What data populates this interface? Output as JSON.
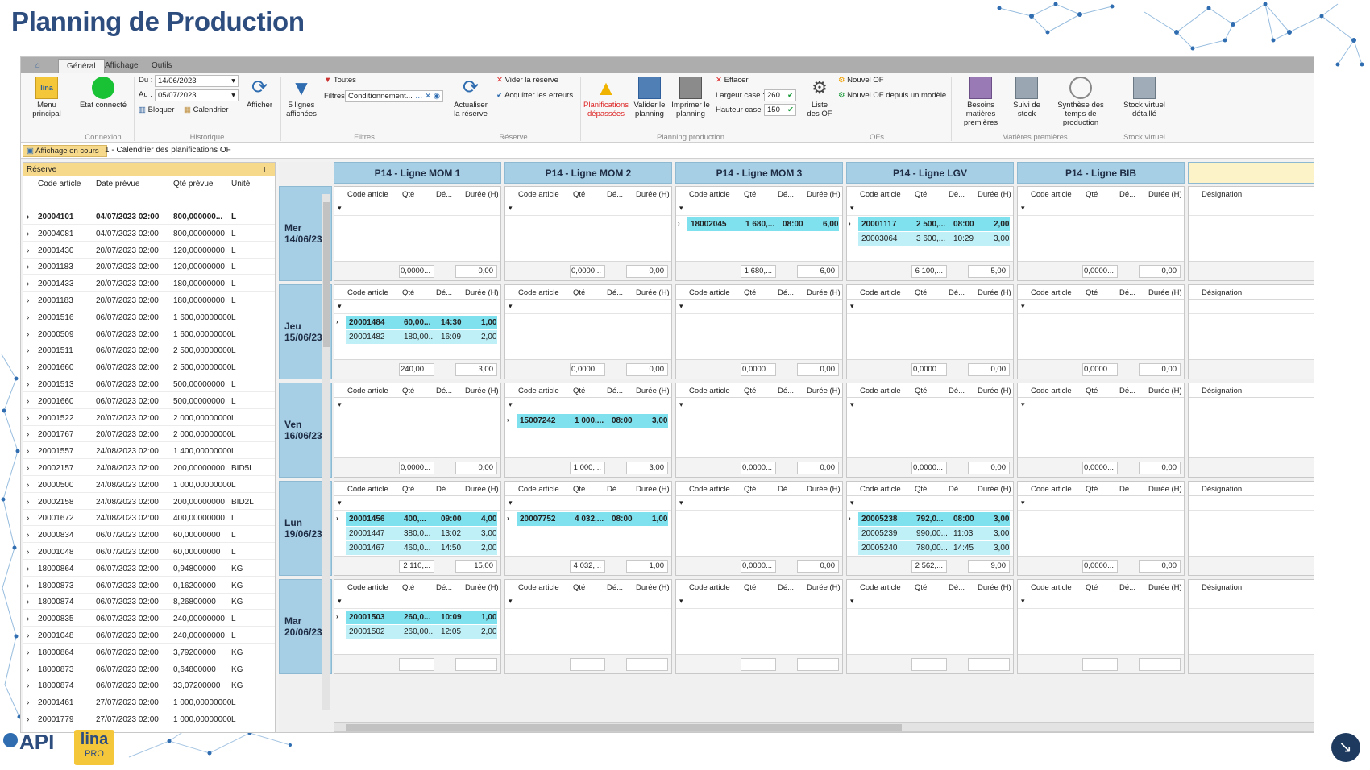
{
  "page_title": "Planning de Production",
  "tabs": [
    "Général",
    "Affichage",
    "Outils"
  ],
  "ribbon": {
    "menu_principal": "Menu principal",
    "etat_connecte": "Etat connecté",
    "du_label": "Du :",
    "du_value": "14/06/2023",
    "au_label": "Au :",
    "au_value": "05/07/2023",
    "bloquer": "Bloquer",
    "calendrier": "Calendrier",
    "afficher": "Afficher",
    "lignes_affichees": "5 lignes affichées",
    "toutes": "Toutes",
    "filtres_label": "Filtres",
    "filtres_value": "Conditionnement...",
    "actualiser": "Actualiser la réserve",
    "vider": "Vider la réserve",
    "acquitter": "Acquitter les erreurs",
    "planif_depassees": "Planifications dépassées",
    "valider": "Valider le planning",
    "imprimer": "Imprimer le planning",
    "effacer": "Effacer",
    "largeur_label": "Largeur case :",
    "largeur_value": "260",
    "hauteur_label": "Hauteur case :",
    "hauteur_value": "150",
    "liste_of": "Liste des OF",
    "nouvel_of": "Nouvel OF",
    "nouvel_of_modele": "Nouvel OF depuis un modèle",
    "besoins": "Besoins matières premières",
    "suivi_stock": "Suivi de stock",
    "synthese": "Synthèse des temps de production",
    "stock_virtuel": "Stock virtuel détaillé",
    "groups": [
      "Connexion",
      "Historique",
      "Filtres",
      "Réserve",
      "Planning production",
      "OFs",
      "Matières premières",
      "Stock virtuel"
    ]
  },
  "current_view": {
    "label": "Affichage en cours :",
    "value": "1 - Calendrier des planifications OF"
  },
  "reserve": {
    "title": "Réserve",
    "columns": [
      "Code article",
      "Date prévue",
      "Qté prévue",
      "Unité"
    ],
    "rows": [
      [
        "20004101",
        "04/07/2023 02:00",
        "800,000000...",
        "L"
      ],
      [
        "20004081",
        "04/07/2023 02:00",
        "800,00000000",
        "L"
      ],
      [
        "20001430",
        "20/07/2023 02:00",
        "120,00000000",
        "L"
      ],
      [
        "20001183",
        "20/07/2023 02:00",
        "120,00000000",
        "L"
      ],
      [
        "20001433",
        "20/07/2023 02:00",
        "180,00000000",
        "L"
      ],
      [
        "20001183",
        "20/07/2023 02:00",
        "180,00000000",
        "L"
      ],
      [
        "20001516",
        "06/07/2023 02:00",
        "1 600,00000000",
        "L"
      ],
      [
        "20000509",
        "06/07/2023 02:00",
        "1 600,00000000",
        "L"
      ],
      [
        "20001511",
        "06/07/2023 02:00",
        "2 500,00000000",
        "L"
      ],
      [
        "20001660",
        "06/07/2023 02:00",
        "2 500,00000000",
        "L"
      ],
      [
        "20001513",
        "06/07/2023 02:00",
        "500,00000000",
        "L"
      ],
      [
        "20001660",
        "06/07/2023 02:00",
        "500,00000000",
        "L"
      ],
      [
        "20001522",
        "20/07/2023 02:00",
        "2 000,00000000",
        "L"
      ],
      [
        "20001767",
        "20/07/2023 02:00",
        "2 000,00000000",
        "L"
      ],
      [
        "20001557",
        "24/08/2023 02:00",
        "1 400,00000000",
        "L"
      ],
      [
        "20002157",
        "24/08/2023 02:00",
        "200,00000000",
        "BID5L"
      ],
      [
        "20000500",
        "24/08/2023 02:00",
        "1 000,00000000",
        "L"
      ],
      [
        "20002158",
        "24/08/2023 02:00",
        "200,00000000",
        "BID2L"
      ],
      [
        "20001672",
        "24/08/2023 02:00",
        "400,00000000",
        "L"
      ],
      [
        "20000834",
        "06/07/2023 02:00",
        "60,00000000",
        "L"
      ],
      [
        "20001048",
        "06/07/2023 02:00",
        "60,00000000",
        "L"
      ],
      [
        "18000864",
        "06/07/2023 02:00",
        "0,94800000",
        "KG"
      ],
      [
        "18000873",
        "06/07/2023 02:00",
        "0,16200000",
        "KG"
      ],
      [
        "18000874",
        "06/07/2023 02:00",
        "8,26800000",
        "KG"
      ],
      [
        "20000835",
        "06/07/2023 02:00",
        "240,00000000",
        "L"
      ],
      [
        "20001048",
        "06/07/2023 02:00",
        "240,00000000",
        "L"
      ],
      [
        "18000864",
        "06/07/2023 02:00",
        "3,79200000",
        "KG"
      ],
      [
        "18000873",
        "06/07/2023 02:00",
        "0,64800000",
        "KG"
      ],
      [
        "18000874",
        "06/07/2023 02:00",
        "33,07200000",
        "KG"
      ],
      [
        "20001461",
        "27/07/2023 02:00",
        "1 000,00000000",
        "L"
      ],
      [
        "20001779",
        "27/07/2023 02:00",
        "1 000,00000000",
        "L"
      ]
    ]
  },
  "planning": {
    "lines": [
      "P14 - Ligne MOM 1",
      "P14 - Ligne MOM 2",
      "P14 - Ligne MOM 3",
      "P14 - Ligne LGV",
      "P14 - Ligne BIB"
    ],
    "cell_columns": [
      "Code article",
      "Qté",
      "Dé...",
      "Durée (H)"
    ],
    "extra_column": "Désignation",
    "days": [
      {
        "name": "Mer",
        "date": "14/06/23",
        "cells": [
          {
            "rows": [],
            "total_qty": "0,0000...",
            "total_dur": "0,00"
          },
          {
            "rows": [],
            "total_qty": "0,0000...",
            "total_dur": "0,00"
          },
          {
            "rows": [
              [
                "18002045",
                "1 680,...",
                "08:00",
                "6,00"
              ]
            ],
            "total_qty": "1 680,...",
            "total_dur": "6,00"
          },
          {
            "rows": [
              [
                "20001117",
                "2 500,...",
                "08:00",
                "2,00"
              ],
              [
                "20003064",
                "3 600,...",
                "10:29",
                "3,00"
              ]
            ],
            "total_qty": "6 100,...",
            "total_dur": "5,00"
          },
          {
            "rows": [],
            "total_qty": "0,0000...",
            "total_dur": "0,00"
          }
        ]
      },
      {
        "name": "Jeu",
        "date": "15/06/23",
        "cells": [
          {
            "rows": [
              [
                "20001484",
                "60,00...",
                "14:30",
                "1,00"
              ],
              [
                "20001482",
                "180,00...",
                "16:09",
                "2,00"
              ]
            ],
            "total_qty": "240,00...",
            "total_dur": "3,00"
          },
          {
            "rows": [],
            "total_qty": "0,0000...",
            "total_dur": "0,00"
          },
          {
            "rows": [],
            "total_qty": "0,0000...",
            "total_dur": "0,00"
          },
          {
            "rows": [],
            "total_qty": "0,0000...",
            "total_dur": "0,00"
          },
          {
            "rows": [],
            "total_qty": "0,0000...",
            "total_dur": "0,00"
          }
        ]
      },
      {
        "name": "Ven",
        "date": "16/06/23",
        "cells": [
          {
            "rows": [],
            "total_qty": "0,0000...",
            "total_dur": "0,00"
          },
          {
            "rows": [
              [
                "15007242",
                "1 000,...",
                "08:00",
                "3,00"
              ]
            ],
            "total_qty": "1 000,...",
            "total_dur": "3,00"
          },
          {
            "rows": [],
            "total_qty": "0,0000...",
            "total_dur": "0,00"
          },
          {
            "rows": [],
            "total_qty": "0,0000...",
            "total_dur": "0,00"
          },
          {
            "rows": [],
            "total_qty": "0,0000...",
            "total_dur": "0,00"
          }
        ]
      },
      {
        "name": "Lun",
        "date": "19/06/23",
        "cells": [
          {
            "rows": [
              [
                "20001456",
                "400,...",
                "09:00",
                "4,00"
              ],
              [
                "20001447",
                "380,0...",
                "13:02",
                "3,00"
              ],
              [
                "20001467",
                "460,0...",
                "14:50",
                "2,00"
              ]
            ],
            "total_qty": "2 110,...",
            "total_dur": "15,00"
          },
          {
            "rows": [
              [
                "20007752",
                "4 032,...",
                "08:00",
                "1,00"
              ]
            ],
            "total_qty": "4 032,...",
            "total_dur": "1,00"
          },
          {
            "rows": [],
            "total_qty": "0,0000...",
            "total_dur": "0,00"
          },
          {
            "rows": [
              [
                "20005238",
                "792,0...",
                "08:00",
                "3,00"
              ],
              [
                "20005239",
                "990,00...",
                "11:03",
                "3,00"
              ],
              [
                "20005240",
                "780,00...",
                "14:45",
                "3,00"
              ]
            ],
            "total_qty": "2 562,...",
            "total_dur": "9,00"
          },
          {
            "rows": [],
            "total_qty": "0,0000...",
            "total_dur": "0,00"
          }
        ]
      },
      {
        "name": "Mar",
        "date": "20/06/23",
        "cells": [
          {
            "rows": [
              [
                "20001503",
                "260,0...",
                "10:09",
                "1,00"
              ],
              [
                "20001502",
                "260,00...",
                "12:05",
                "2,00"
              ]
            ],
            "total_qty": "",
            "total_dur": ""
          },
          {
            "rows": [],
            "total_qty": "",
            "total_dur": ""
          },
          {
            "rows": [],
            "total_qty": "",
            "total_dur": ""
          },
          {
            "rows": [],
            "total_qty": "",
            "total_dur": ""
          },
          {
            "rows": [],
            "total_qty": "",
            "total_dur": ""
          }
        ]
      }
    ]
  },
  "colors": {
    "title": "#2e4d7f",
    "header": "#a6cfe6",
    "row_first": "#7fe0ee",
    "row_next": "#bff0f7",
    "reserve_head": "#f7d98b"
  },
  "logo": {
    "brand": "API",
    "product": "lina",
    "sub": "PRO"
  }
}
